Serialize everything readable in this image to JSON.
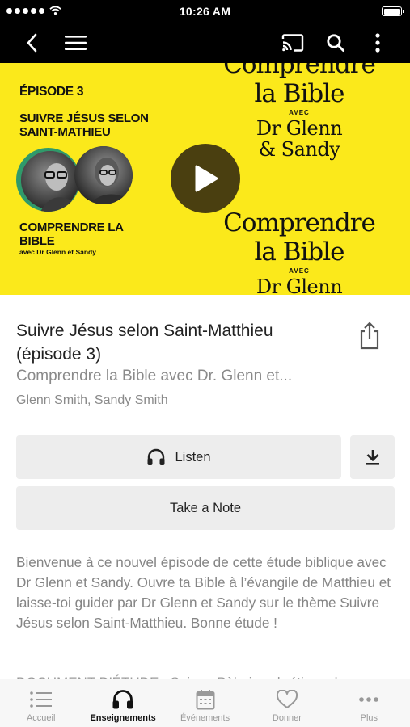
{
  "status_bar": {
    "time": "10:26 AM"
  },
  "hero": {
    "episode_label": "ÉPISODE 3",
    "episode_title": "SUIVRE JÉSUS SELON SAINT-MATHIEU",
    "series_title": "COMPRENDRE LA BIBLE",
    "series_subtitle": "avec Dr Glenn et Sandy",
    "art_block_top": {
      "line1": "Comprendre",
      "line2": "la Bible",
      "avec": "AVEC",
      "name1": "Dr Glenn",
      "name2": "& Sandy"
    },
    "art_block_bottom": {
      "line1": "Comprendre",
      "line2": "la Bible",
      "avec": "AVEC",
      "name1": "Dr Glenn"
    }
  },
  "episode": {
    "title": "Suivre Jésus selon Saint-Matthieu (épisode 3)",
    "series": "Comprendre la Bible avec Dr. Glenn et...",
    "authors": "Glenn Smith, Sandy Smith"
  },
  "actions": {
    "listen_label": "Listen",
    "note_label": "Take a Note"
  },
  "description": {
    "text": "Bienvenue à ce nouvel épisode de cette étude biblique avec Dr Glenn et Sandy.  Ouvre ta Bible à l’évangile de Matthieu et laisse-toi guider par Dr Glenn et Sandy sur le thème Suivre Jésus selon Saint-Matthieu. Bonne étude !",
    "cut_line": "DOCUMENT D’ÉTUDE : Soi... ...Pèlerins chrétiens d..."
  },
  "tabs": [
    {
      "label": "Accueil",
      "icon": "list-icon",
      "active": false
    },
    {
      "label": "Enseignements",
      "icon": "headphones-icon",
      "active": true
    },
    {
      "label": "Événements",
      "icon": "calendar-icon",
      "active": false
    },
    {
      "label": "Donner",
      "icon": "heart-icon",
      "active": false
    },
    {
      "label": "Plus",
      "icon": "more-horizontal-icon",
      "active": false
    }
  ],
  "colors": {
    "hero_background": "#fbe91b",
    "play_button": "#4a3f10",
    "bar_background": "#000000",
    "button_background": "#ededed",
    "muted_text": "#8a8a8a"
  }
}
